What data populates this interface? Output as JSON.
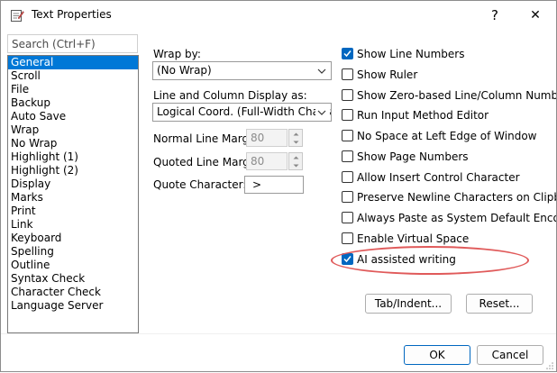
{
  "window": {
    "title": "Text Properties",
    "help_glyph": "?",
    "close_glyph": "✕"
  },
  "search": {
    "placeholder": "Search (Ctrl+F)"
  },
  "categories": {
    "selected": "General",
    "items": [
      "General",
      "Scroll",
      "File",
      "Backup",
      "Auto Save",
      "Wrap",
      "No Wrap",
      "Highlight (1)",
      "Highlight (2)",
      "Display",
      "Marks",
      "Print",
      "Link",
      "Keyboard",
      "Spelling",
      "Outline",
      "Syntax Check",
      "Character Check",
      "Language Server"
    ]
  },
  "general": {
    "wrap_by": {
      "label": "Wrap by:",
      "value": "(No Wrap)"
    },
    "line_column_display": {
      "label": "Line and Column Display as:",
      "value": "Logical Coord. (Full-Width Char. a"
    },
    "normal_line_margin": {
      "label": "Normal Line Margin",
      "value": "80"
    },
    "quoted_line_margin": {
      "label": "Quoted Line Margin",
      "value": "80"
    },
    "quote_character": {
      "label": "Quote Character:",
      "value": ">"
    },
    "checkboxes": [
      {
        "label": "Show Line Numbers",
        "checked": true
      },
      {
        "label": "Show Ruler",
        "checked": false
      },
      {
        "label": "Show Zero-based Line/Column Number",
        "checked": false
      },
      {
        "label": "Run Input Method Editor",
        "checked": false
      },
      {
        "label": "No Space at Left Edge of Window",
        "checked": false
      },
      {
        "label": "Show Page Numbers",
        "checked": false
      },
      {
        "label": "Allow Insert Control Character",
        "checked": false
      },
      {
        "label": "Preserve Newline Characters on Clipboard",
        "checked": false
      },
      {
        "label": "Always Paste as System Default Encoding",
        "checked": false
      },
      {
        "label": "Enable Virtual Space",
        "checked": false
      },
      {
        "label": "AI assisted writing",
        "checked": true
      }
    ],
    "tab_indent_label": "Tab/Indent...",
    "reset_label": "Reset..."
  },
  "footer": {
    "ok_label": "OK",
    "cancel_label": "Cancel"
  },
  "colors": {
    "accent": "#0067c0",
    "selection": "#0078d7",
    "annotation": "#e05a5a"
  }
}
